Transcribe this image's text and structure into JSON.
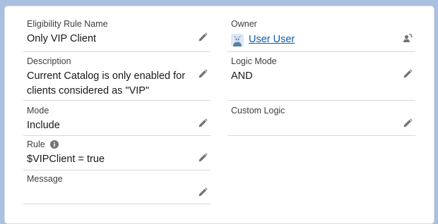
{
  "left_fields": [
    {
      "label": "Eligibility Rule Name",
      "value": "Only VIP Client"
    },
    {
      "label": "Description",
      "value_line1": "Current Catalog is only enabled for",
      "value_line2": "clients considered as \"VIP\""
    },
    {
      "label": "Mode",
      "value": "Include"
    },
    {
      "label": "Rule",
      "value": "$VIPClient = true",
      "info_icon": "info-icon"
    },
    {
      "label": "Message",
      "value": ""
    }
  ],
  "right_fields": [
    {
      "label": "Owner",
      "value": "User User",
      "avatar_icon": "user-avatar-icon",
      "action_icon": "change-owner-icon"
    },
    {
      "label": "Logic Mode",
      "value": "AND"
    },
    {
      "label": "Custom Logic",
      "value": ""
    }
  ],
  "icons": {
    "edit": "pencil-icon"
  },
  "colors": {
    "link": "#0b5cab",
    "background": "#a9c0e0",
    "divider": "#d8d8d8",
    "icon": "#747474"
  }
}
